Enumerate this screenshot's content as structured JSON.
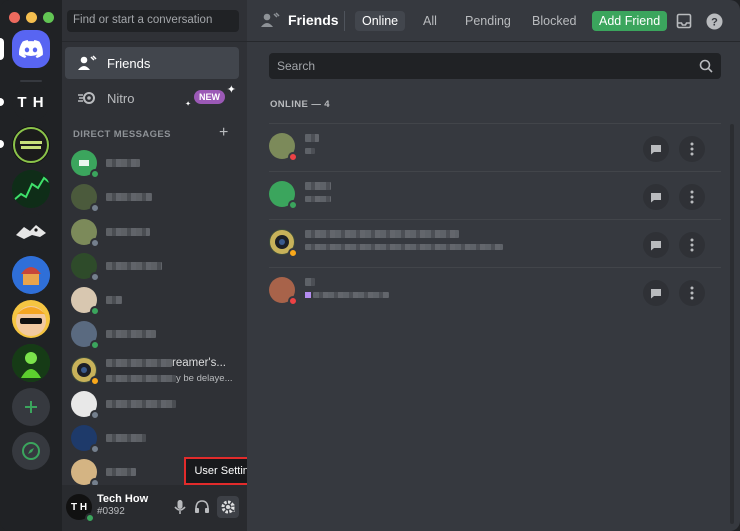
{
  "colors": {
    "blurple": "#5865f2",
    "green": "#3ba55d",
    "red_close": "#ed6a5e",
    "yellow_min": "#f5bf4f",
    "green_max": "#62c554",
    "status_online": "#3ba55d",
    "status_dnd": "#ed4245",
    "status_idle": "#faa81a",
    "status_offline": "#747f8d",
    "highlight_border": "#e22b2b"
  },
  "rail": {
    "servers": [
      {
        "name": "home-discord",
        "icon": "discord-logo-icon"
      },
      {
        "name": "th-server",
        "icon": "th-text-icon",
        "text": "T H"
      },
      {
        "name": "level-up-server",
        "icon": "level-up-logo-icon"
      },
      {
        "name": "green-chart-server",
        "icon": "chart-image-icon"
      },
      {
        "name": "creature-server",
        "icon": "creature-image-icon"
      },
      {
        "name": "cupcake-server",
        "icon": "cupcake-icon"
      },
      {
        "name": "sunglasses-server",
        "icon": "sunglasses-face-icon"
      },
      {
        "name": "green-figure-server",
        "icon": "green-figure-icon"
      }
    ],
    "add_server_icon": "plus-icon",
    "explore_icon": "compass-icon"
  },
  "sidebar": {
    "search_placeholder": "Find or start a conversation",
    "friends_label": "Friends",
    "nitro_label": "Nitro",
    "nitro_badge": "NEW",
    "dm_header": "DIRECT MESSAGES",
    "dm_add": "+",
    "dm_partial_name": "reamer's...",
    "dm_partial_sub": "y be delaye..."
  },
  "user_panel": {
    "avatar_text": "T H",
    "name": "Tech How",
    "tag": "#0392",
    "mic_icon": "microphone-icon",
    "headset_icon": "headphones-icon",
    "settings_icon": "gear-icon"
  },
  "tooltip": {
    "text": "User Settings"
  },
  "topbar": {
    "title": "Friends",
    "tabs": [
      "Online",
      "All",
      "Pending",
      "Blocked"
    ],
    "add_friend": "Add Friend",
    "inbox_icon": "inbox-icon",
    "help_icon": "help-icon"
  },
  "main": {
    "search_placeholder": "Search",
    "online_header": "ONLINE — 4"
  }
}
